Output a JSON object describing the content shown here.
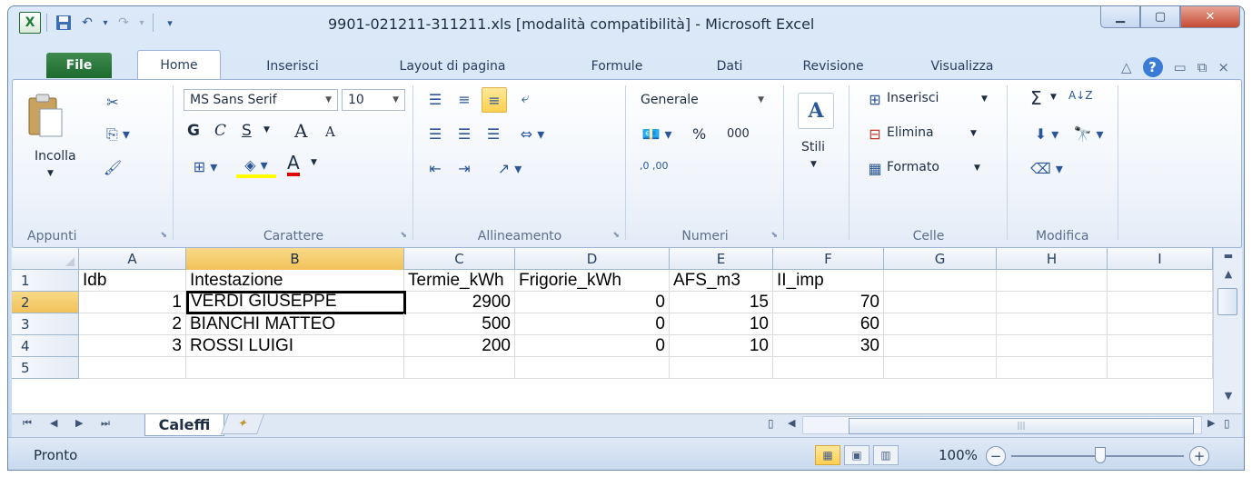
{
  "window": {
    "title": "9901-021211-311211.xls  [modalità compatibilità]  -  Microsoft Excel",
    "controls": {
      "minimize": "▁",
      "maximize": "▢",
      "close": "✕"
    }
  },
  "qat": {
    "app_icon": "X",
    "save_icon": "💾",
    "undo_icon": "↶",
    "redo_icon": "↷",
    "customize_icon": "▾"
  },
  "tabs": [
    "File",
    "Home",
    "Inserisci",
    "Layout di pagina",
    "Formule",
    "Dati",
    "Revisione",
    "Visualizza"
  ],
  "ribbon": {
    "clipboard": {
      "paste": "Incolla",
      "label": "Appunti"
    },
    "font": {
      "name": "MS Sans Serif",
      "size": "10",
      "bold": "G",
      "italic": "C",
      "underline": "S",
      "grow": "A",
      "shrink": "A",
      "color": "A",
      "label": "Carattere"
    },
    "alignment": {
      "label": "Allineamento"
    },
    "number": {
      "format": "Generale",
      "percent": "%",
      "thousands": "000",
      "inc": ",0 ,00",
      "label": "Numeri"
    },
    "styles": {
      "label": "Stili"
    },
    "cells": {
      "insert": "Inserisci",
      "delete": "Elimina",
      "format": "Formato",
      "label": "Celle"
    },
    "editing": {
      "sum": "Σ",
      "sort": "A↓Z",
      "label": "Modifica"
    }
  },
  "sheet": {
    "columns": [
      "A",
      "B",
      "C",
      "D",
      "E",
      "F",
      "G",
      "H",
      "I"
    ],
    "rows": [
      "1",
      "2",
      "3",
      "4",
      "5"
    ],
    "data": [
      [
        "Idb",
        "Intestazione",
        "Termie_kWh",
        "Frigorie_kWh",
        "AFS_m3",
        "II_imp",
        "",
        "",
        ""
      ],
      [
        "1",
        "VERDI GIUSEPPE",
        "2900",
        "0",
        "15",
        "70",
        "",
        "",
        ""
      ],
      [
        "2",
        "BIANCHI MATTEO",
        "500",
        "0",
        "10",
        "60",
        "",
        "",
        ""
      ],
      [
        "3",
        "ROSSI LUIGI",
        "200",
        "0",
        "10",
        "30",
        "",
        "",
        ""
      ],
      [
        "",
        "",
        "",
        "",
        "",
        "",
        "",
        "",
        ""
      ]
    ]
  },
  "sheet_tabs": {
    "active": "Caleffi"
  },
  "status": {
    "text": "Pronto",
    "zoom": "100%"
  }
}
